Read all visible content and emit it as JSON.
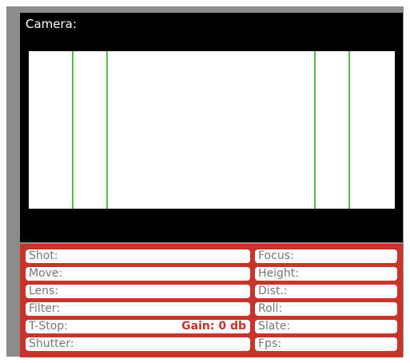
{
  "camera": {
    "label": "Camera:"
  },
  "fields_left": [
    {
      "id": "shot",
      "label": "Shot:"
    },
    {
      "id": "move",
      "label": "Move:"
    },
    {
      "id": "lens",
      "label": "Lens:"
    },
    {
      "id": "filter",
      "label": "Filter:"
    },
    {
      "id": "tstop",
      "label": "T-Stop:"
    },
    {
      "id": "shutter",
      "label": "Shutter:"
    }
  ],
  "gain": {
    "label": "Gain: 0 db"
  },
  "fields_right": [
    {
      "id": "focus",
      "label": "Focus:"
    },
    {
      "id": "height",
      "label": "Height:"
    },
    {
      "id": "dist",
      "label": "Dist.:"
    },
    {
      "id": "roll",
      "label": "Roll:"
    },
    {
      "id": "slate",
      "label": "Slate:"
    },
    {
      "id": "fps",
      "label": "Fps:"
    }
  ],
  "colors": {
    "panel": "#c8332b",
    "guide_lines": "#55bb55",
    "viewer_background": "#000000",
    "outer_frame": "#8c8c8c"
  }
}
